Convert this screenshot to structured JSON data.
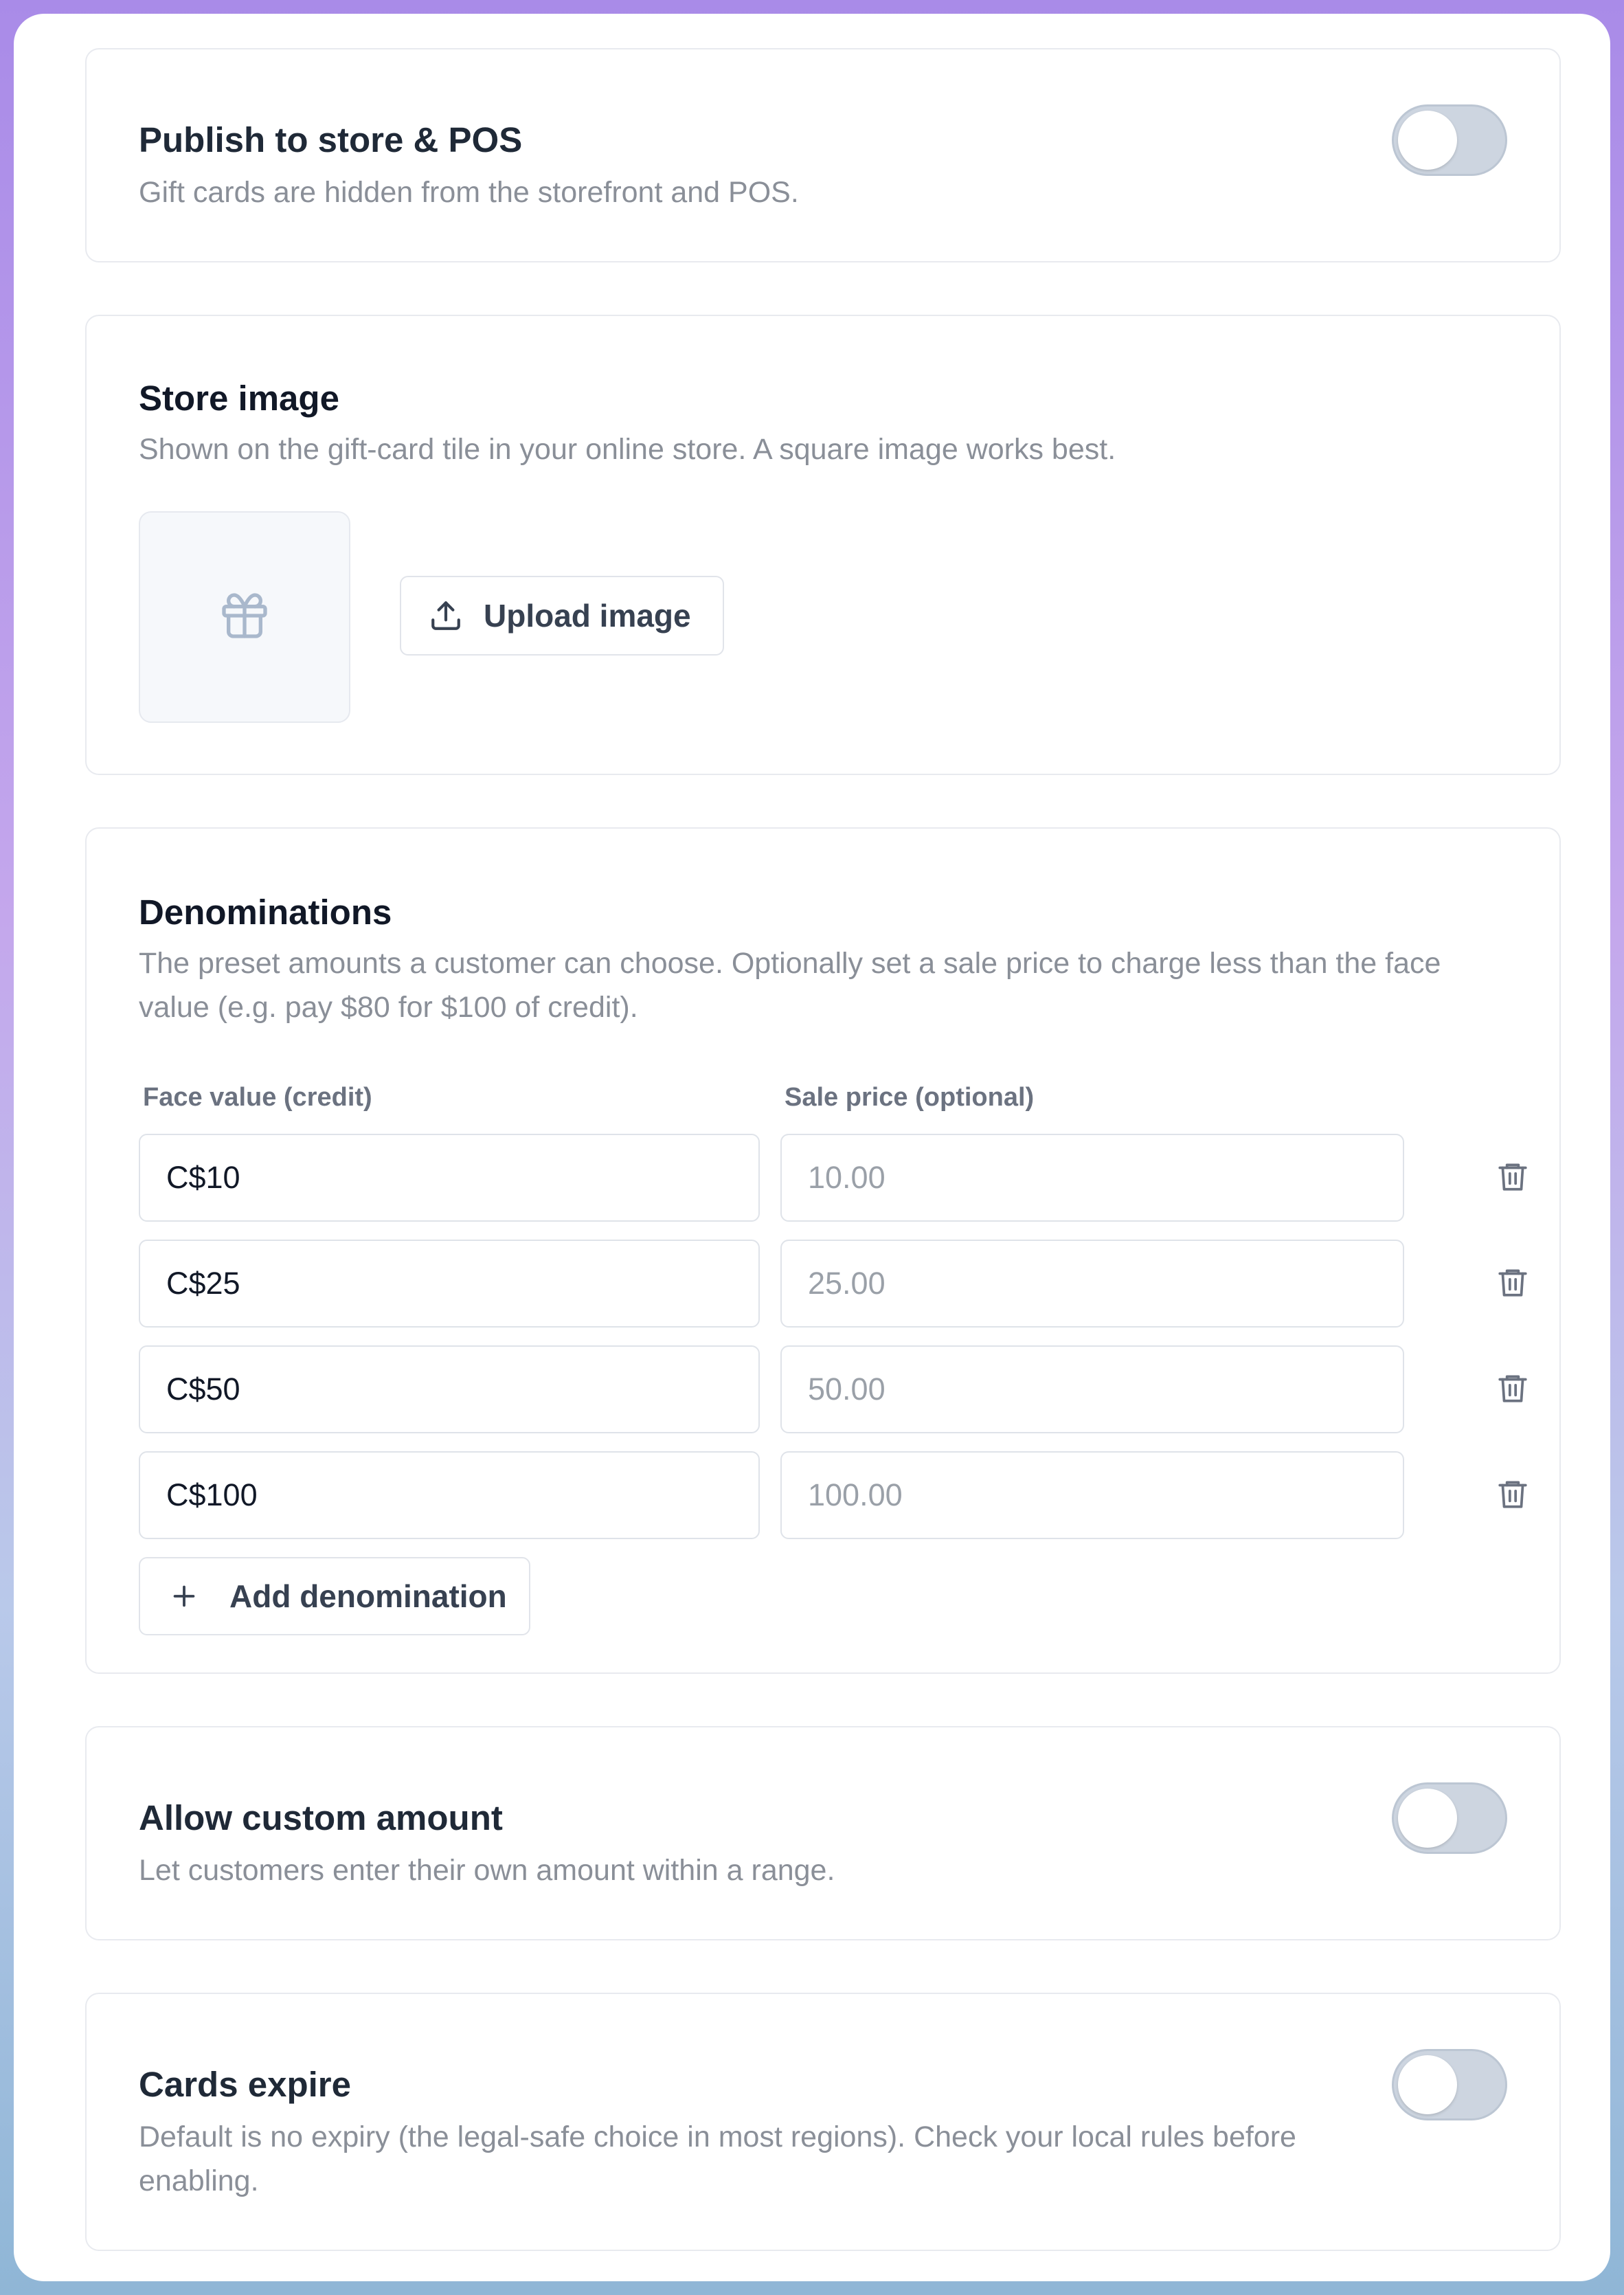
{
  "publish": {
    "title": "Publish to store & POS",
    "description": "Gift cards are hidden from the storefront and POS.",
    "enabled": false
  },
  "store_image": {
    "title": "Store image",
    "description": "Shown on the gift-card tile in your online store. A square image works best.",
    "placeholder_icon": "gift-icon",
    "upload_label": "Upload image",
    "upload_icon": "upload-icon"
  },
  "denominations": {
    "title": "Denominations",
    "description": "The preset amounts a customer can choose. Optionally set a sale price to charge less than the face value (e.g. pay $80 for $100 of credit).",
    "face_value_label": "Face value (credit)",
    "sale_price_label": "Sale price (optional)",
    "rows": [
      {
        "face_value": "C$10",
        "sale_price_placeholder": "10.00"
      },
      {
        "face_value": "C$25",
        "sale_price_placeholder": "25.00"
      },
      {
        "face_value": "C$50",
        "sale_price_placeholder": "50.00"
      },
      {
        "face_value": "C$100",
        "sale_price_placeholder": "100.00"
      }
    ],
    "delete_icon": "trash-icon",
    "add_label": "Add denomination",
    "add_icon": "plus-icon"
  },
  "custom_amount": {
    "title": "Allow custom amount",
    "description": "Let customers enter their own amount within a range.",
    "enabled": false
  },
  "expire": {
    "title": "Cards expire",
    "description": "Default is no expiry (the legal-safe choice in most regions). Check your local rules before enabling.",
    "enabled": false
  },
  "colors": {
    "toggle_off": "#cdd5e0",
    "border": "#e8eaef",
    "muted_text": "#8a8f98",
    "title_text": "#111827"
  }
}
